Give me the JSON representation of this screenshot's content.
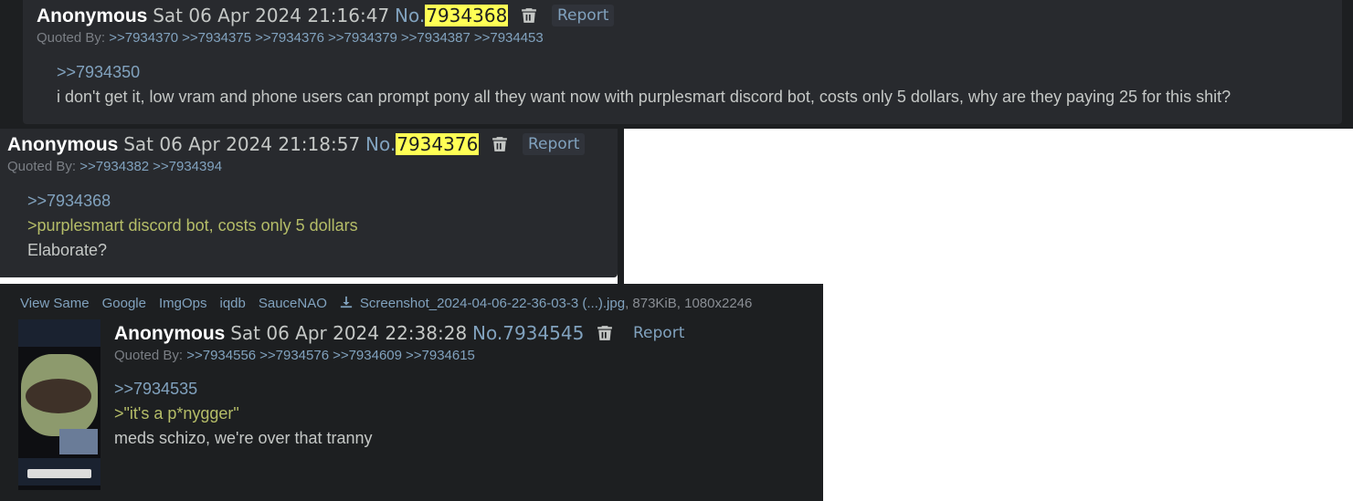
{
  "posts": [
    {
      "name": "Anonymous",
      "date": "Sat 06 Apr 2024 21:16:47",
      "no_prefix": "No.",
      "no": "7934368",
      "report": "Report",
      "quoted_by_label": "Quoted By:",
      "quoted_by": [
        ">>7934370",
        ">>7934375",
        ">>7934376",
        ">>7934379",
        ">>7934387",
        ">>7934453"
      ],
      "lines": [
        {
          "type": "quotelink",
          "text": ">>7934350"
        },
        {
          "type": "text",
          "text": "i don't get it, low vram and phone users can prompt pony all they want now with purplesmart discord bot, costs only 5 dollars, why are they paying 25 for this shit?"
        }
      ]
    },
    {
      "name": "Anonymous",
      "date": "Sat 06 Apr 2024 21:18:57",
      "no_prefix": "No.",
      "no": "7934376",
      "report": "Report",
      "quoted_by_label": "Quoted By:",
      "quoted_by": [
        ">>7934382",
        ">>7934394"
      ],
      "lines": [
        {
          "type": "quotelink",
          "text": ">>7934368"
        },
        {
          "type": "greentext",
          "text": ">purplesmart discord bot, costs only 5 dollars"
        },
        {
          "type": "text",
          "text": "Elaborate?"
        }
      ]
    },
    {
      "file": {
        "links": [
          "View Same",
          "Google",
          "ImgOps",
          "iqdb",
          "SauceNAO"
        ],
        "filename": "Screenshot_2024-04-06-22-36-03-3 (...).jpg",
        "meta": ", 873KiB, 1080x2246"
      },
      "name": "Anonymous",
      "date": "Sat 06 Apr 2024 22:38:28",
      "no_prefix": "No.",
      "no": "7934545",
      "report": "Report",
      "quoted_by_label": "Quoted By:",
      "quoted_by": [
        ">>7934556",
        ">>7934576",
        ">>7934609",
        ">>7934615"
      ],
      "lines": [
        {
          "type": "quotelink",
          "text": ">>7934535"
        },
        {
          "type": "greentext",
          "text": ">\"it's a p*nygger\""
        },
        {
          "type": "text",
          "text": "meds schizo, we're over that tranny"
        }
      ]
    }
  ],
  "colors": {
    "background": "#1d1f21",
    "post": "#282a2e",
    "link": "#81a2be",
    "greentext": "#b5bd68",
    "highlight": "#ffff55"
  },
  "icons": {
    "delete": "trash-icon",
    "download": "download-icon"
  }
}
